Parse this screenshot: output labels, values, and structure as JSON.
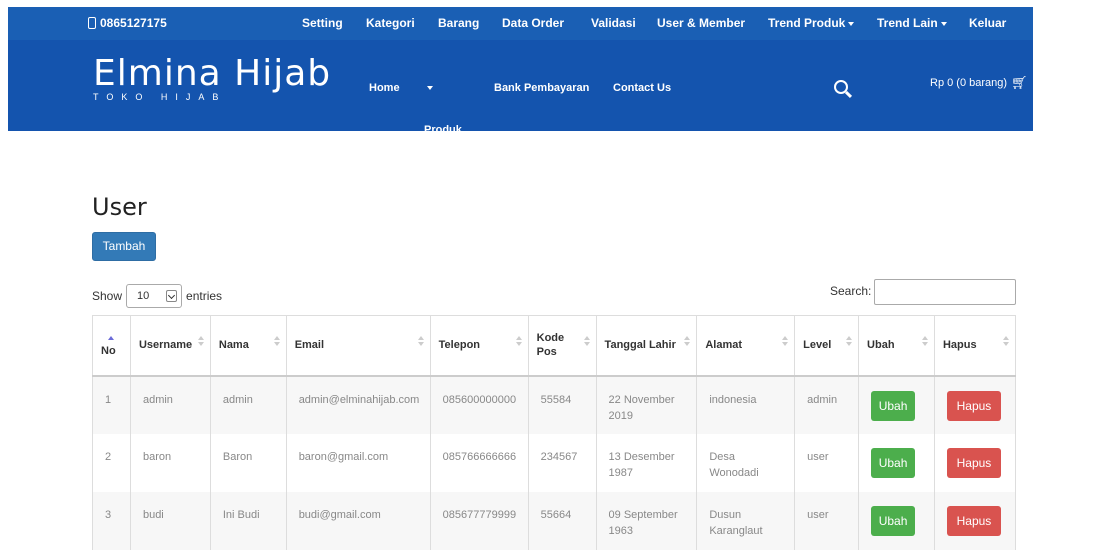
{
  "topbar": {
    "phone": "0865127175",
    "nav": [
      "Setting",
      "Kategori",
      "Barang",
      "Data Order",
      "Validasi",
      "User & Member",
      "Trend Produk",
      "Trend Lain",
      "Keluar"
    ]
  },
  "header": {
    "brand": "Elmina Hijab",
    "tagline": "TOKO HIJAB",
    "nav": [
      "Home",
      "Produk",
      "Bank Pembayaran",
      "Contact Us"
    ],
    "cart": "Rp 0 (0 barang)"
  },
  "page": {
    "title": "User",
    "add_button": "Tambah",
    "show_label": "Show",
    "entries_value": "10",
    "entries_label": "entries",
    "search_label": "Search:"
  },
  "table": {
    "columns": [
      "No",
      "Username",
      "Nama",
      "Email",
      "Telepon",
      "Kode Pos",
      "Tanggal Lahir",
      "Alamat",
      "Level",
      "Ubah",
      "Hapus"
    ],
    "rows": [
      {
        "no": "1",
        "username": "admin",
        "nama": "admin",
        "email": "admin@elminahijab.com",
        "telepon": "085600000000",
        "kodepos": "55584",
        "tanggal": "22 November 2019",
        "alamat": "indonesia",
        "level": "admin",
        "ubah": "Ubah",
        "hapus": "Hapus"
      },
      {
        "no": "2",
        "username": "baron",
        "nama": "Baron",
        "email": "baron@gmail.com",
        "telepon": "085766666666",
        "kodepos": "234567",
        "tanggal": "13 Desember 1987",
        "alamat": "Desa Wonodadi",
        "level": "user",
        "ubah": "Ubah",
        "hapus": "Hapus"
      },
      {
        "no": "3",
        "username": "budi",
        "nama": "Ini Budi",
        "email": "budi@gmail.com",
        "telepon": "085677779999",
        "kodepos": "55664",
        "tanggal": "09 September 1963",
        "alamat": "Dusun Karanglaut",
        "level": "user",
        "ubah": "Ubah",
        "hapus": "Hapus"
      }
    ]
  },
  "colors": {
    "topbar": "#1a5fb4",
    "header": "#1454ae",
    "primary_button": "#337ab7",
    "success_button": "#4cae4c",
    "danger_button": "#d9534f"
  }
}
